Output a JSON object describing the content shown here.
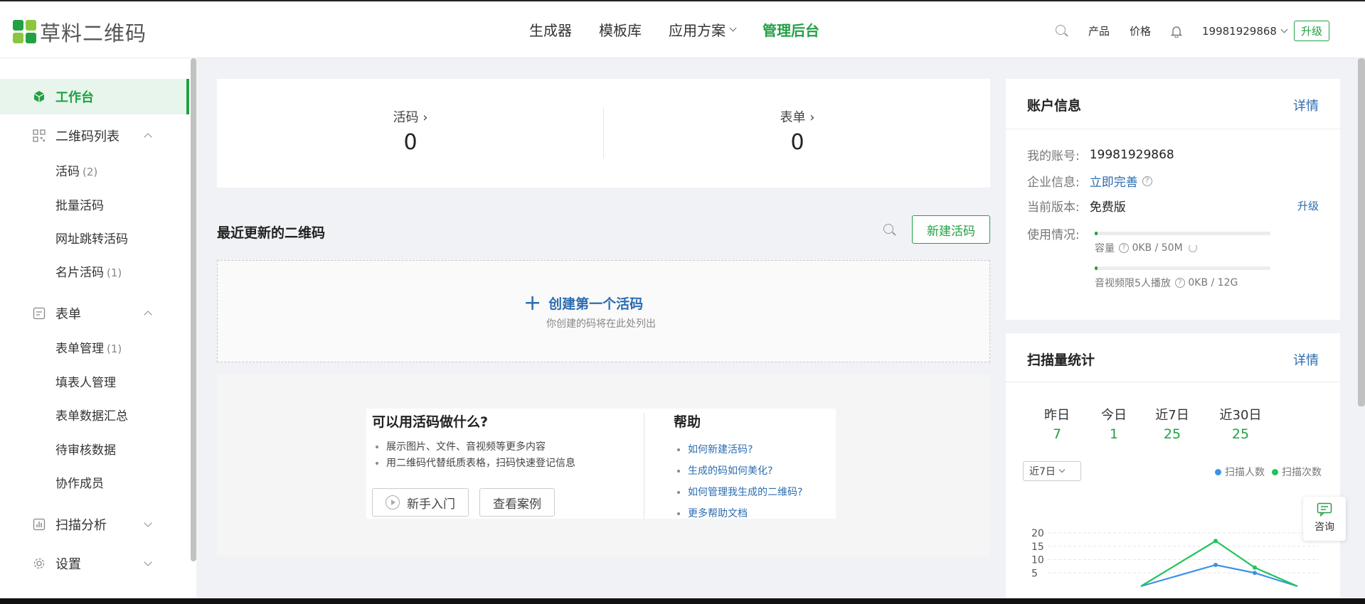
{
  "header": {
    "logo_text": "草料二维码",
    "nav": [
      "生成器",
      "模板库",
      "应用方案",
      "管理后台"
    ],
    "product": "产品",
    "price": "价格",
    "account": "19981929868",
    "upgrade": "升级"
  },
  "sidebar": {
    "workbench": "工作台",
    "qr_list": "二维码列表",
    "huoma": "活码",
    "huoma_count": "(2)",
    "batch": "批量活码",
    "url_jump": "网址跳转活码",
    "card": "名片活码",
    "card_count": "(1)",
    "form": "表单",
    "form_manage": "表单管理",
    "form_manage_count": "(1)",
    "filler_manage": "填表人管理",
    "form_data": "表单数据汇总",
    "pending": "待审核数据",
    "collaborators": "协作成员",
    "scan_analysis": "扫描分析",
    "settings": "设置"
  },
  "stats": {
    "huoma_label": "活码",
    "huoma_value": "0",
    "form_label": "表单",
    "form_value": "0"
  },
  "recent": {
    "title": "最近更新的二维码",
    "new_button": "新建活码",
    "create_first": "创建第一个活码",
    "create_sub": "你创建的码将在此处列出"
  },
  "help": {
    "what_title": "可以用活码做什么?",
    "what_items": [
      "展示图片、文件、音视频等更多内容",
      "用二维码代替纸质表格，扫码快速登记信息"
    ],
    "beginner": "新手入门",
    "cases": "查看案例",
    "help_title": "帮助",
    "help_links": [
      "如何新建活码?",
      "生成的码如何美化?",
      "如何管理我生成的二维码?",
      "更多帮助文档"
    ]
  },
  "account": {
    "title": "账户信息",
    "detail": "详情",
    "acct_label": "我的账号:",
    "acct_value": "19981929868",
    "company_label": "企业信息:",
    "company_value": "立即完善",
    "version_label": "当前版本:",
    "version_value": "免费版",
    "upgrade": "升级",
    "usage_label": "使用情况:",
    "capacity_label": "容量",
    "capacity_value": "0KB / 50M",
    "media_label": "音视频限5人播放",
    "media_value": "0KB / 12G",
    "capacity_fraction": 0.0,
    "media_fraction": 0.0
  },
  "scan": {
    "title": "扫描量统计",
    "detail": "详情",
    "stats": [
      {
        "label": "昨日",
        "value": "7"
      },
      {
        "label": "今日",
        "value": "1"
      },
      {
        "label": "近7日",
        "value": "25"
      },
      {
        "label": "近30日",
        "value": "25"
      }
    ],
    "range": "近7日",
    "legend_people": "扫描人数",
    "legend_times": "扫描次数"
  },
  "consult": "咨询",
  "colors": {
    "green": "#21a144",
    "blue": "#3b93e6",
    "link": "#2b6cb0"
  },
  "chart_data": {
    "type": "line",
    "y_ticks": [
      "20",
      "15",
      "10",
      "5"
    ],
    "ylim": [
      0,
      20
    ],
    "series": [
      {
        "name": "扫描人数",
        "color": "#3b93e6",
        "values": [
          0,
          8,
          5,
          0
        ]
      },
      {
        "name": "扫描次数",
        "color": "#21c45a",
        "values": [
          0,
          17,
          7,
          0
        ]
      }
    ]
  }
}
